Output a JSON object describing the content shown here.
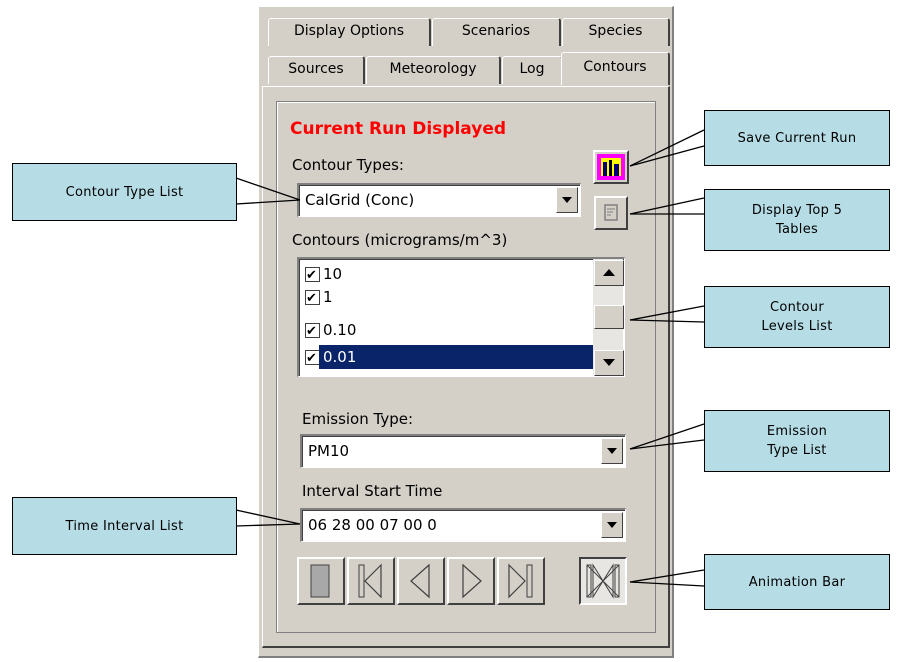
{
  "tabs": {
    "row1": [
      "Display Options",
      "Scenarios",
      "Species"
    ],
    "row2": [
      "Sources",
      "Meteorology",
      "Log",
      "Contours"
    ]
  },
  "current_run": "Current Run Displayed",
  "contour_types": {
    "label": "Contour Types:",
    "value": "CalGrid (Conc)"
  },
  "contours": {
    "label": "Contours (micrograms/m^3)",
    "items": [
      {
        "value": "10",
        "checked": true,
        "selected": false
      },
      {
        "value": "1",
        "checked": true,
        "selected": false
      },
      {
        "value": "0.10",
        "checked": true,
        "selected": false
      },
      {
        "value": "0.01",
        "checked": true,
        "selected": true
      }
    ]
  },
  "emission_type": {
    "label": "Emission Type:",
    "value": "PM10"
  },
  "interval_start": {
    "label": "Interval Start Time",
    "value": "06 28 00 07 00 0"
  },
  "icons": {
    "save_run": "save-run-icon",
    "top5": "top5-tables-icon",
    "animation": [
      "stop-icon",
      "first-frame-icon",
      "previous-frame-icon",
      "play-icon",
      "last-frame-icon",
      "loop-icon"
    ]
  },
  "callouts": {
    "contour_type_list": "Contour Type List",
    "save_current_run": "Save Current Run",
    "display_top5": "Display Top 5 Tables",
    "contour_levels": "Contour Levels List",
    "emission_type": "Emission Type List",
    "time_interval": "Time Interval List",
    "animation_bar": "Animation Bar"
  },
  "colors": {
    "panel": "#d4d0c8",
    "callout": "#b6dde6",
    "title_red": "#ff0000",
    "selection": "#0a246a"
  }
}
